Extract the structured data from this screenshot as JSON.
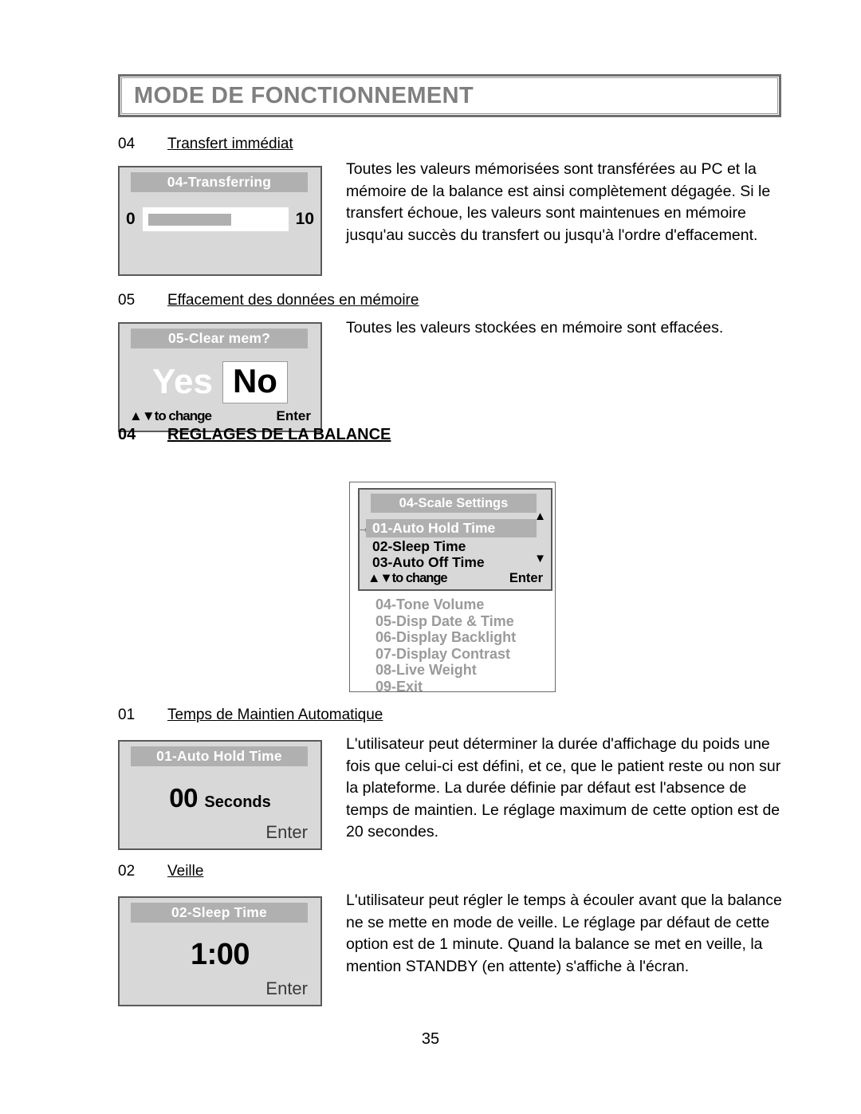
{
  "document": {
    "header_title": "MODE DE FONCTIONNEMENT",
    "page_number": "35"
  },
  "sections": [
    {
      "number": "04",
      "title": "Transfert immédiat",
      "paragraph": "Toutes les valeurs mémorisées sont transférées au PC et la mémoire de la balance est ainsi complètement dégagée. Si le transfert échoue, les valeurs sont maintenues en mémoire jusqu'au succès du transfert ou jusqu'à l'ordre d'effacement."
    },
    {
      "number": "05",
      "title": "Effacement des données en mémoire",
      "paragraph": "Toutes les valeurs stockées en mémoire sont effacées."
    },
    {
      "number": "04",
      "title": "REGLAGES DE LA BALANCE",
      "paragraph": ""
    },
    {
      "number": "01",
      "title": "Temps de Maintien Automatique",
      "paragraph": "L'utilisateur peut déterminer la durée d'affichage du poids une fois que celui-ci est défini, et ce, que le patient reste ou non sur la plateforme. La durée définie par défaut est l'absence de temps de maintien. Le réglage maximum de cette option est de 20 secondes."
    },
    {
      "number": "02",
      "title": "Veille",
      "paragraph": "L'utilisateur peut régler le temps à écouler avant que  la balance ne se mette en mode de veille. Le réglage par défaut de cette option est de 1 minute. Quand la balance se met en veille, la mention STANDBY (en attente) s'affiche à l'écran."
    }
  ],
  "lcd_transferring": {
    "title": "04-Transferring",
    "min_label": "0",
    "max_label": "10",
    "progress_percent": 62
  },
  "lcd_clear_mem": {
    "title": "05-Clear mem?",
    "option_yes": "Yes",
    "option_no": "No",
    "selected": "No",
    "hint_change": "▲▼to change",
    "hint_enter": "Enter"
  },
  "lcd_scale_settings": {
    "title": "04-Scale Settings",
    "selected_item": "01-Auto Hold Time",
    "pointer": "→",
    "visible_items": [
      "02-Sleep Time",
      "03-Auto Off Time"
    ],
    "scroll_up_icon": "▲",
    "scroll_down_icon": "▼",
    "hint_change": "▲▼to change",
    "hint_enter": "Enter",
    "dimmed_items": [
      "04-Tone Volume",
      "05-Disp Date & Time",
      "06-Display Backlight",
      "07-Display Contrast",
      "08-Live Weight",
      "09-Exit"
    ]
  },
  "lcd_auto_hold": {
    "title": "01-Auto Hold Time",
    "value": "00",
    "unit": "Seconds",
    "hint_enter": "Enter"
  },
  "lcd_sleep_time": {
    "title": "02-Sleep Time",
    "value": "1:00",
    "unit": "",
    "hint_enter": "Enter"
  },
  "colors": {
    "header_text": "#7f7f7f",
    "lcd_background": "#d8d8d8",
    "lcd_titlebar": "#b0b0b0",
    "lcd_border": "#5a5a5a",
    "dimmed_text": "#9a9a9a"
  }
}
